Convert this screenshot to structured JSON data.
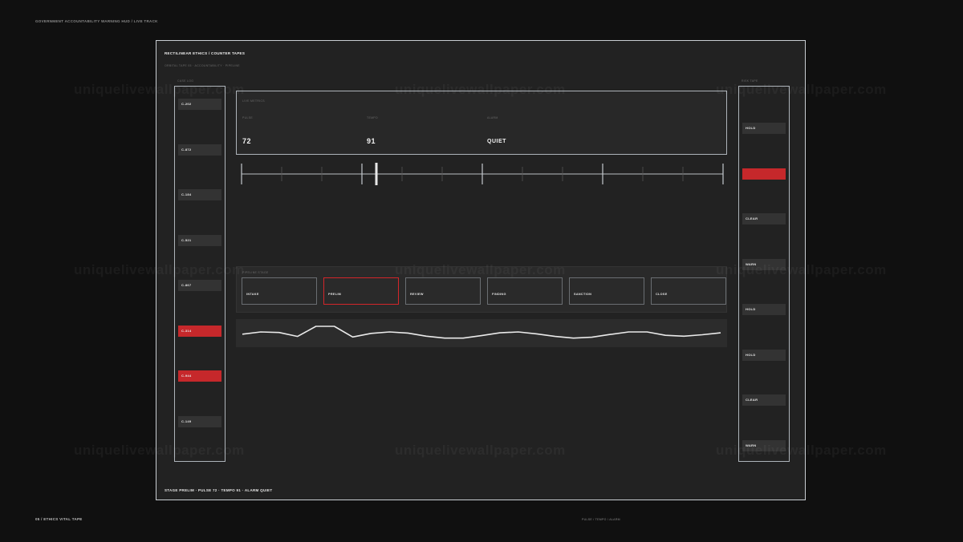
{
  "header": {
    "caption": "GOVERNMENT ACCOUNTABILITY WARNING HUD / LIVE TRACK"
  },
  "footer": {
    "left": "05 / ETHICS VITAL TAPE",
    "middle": "PULSE / TEMPO / ALARM"
  },
  "frame": {
    "title": "RECTILINEAR ETHICS / COUNTER TAPES",
    "subtitle": "ORBITAL TAPE 05 · ACCOUNTABILITY · PIPELINE",
    "status": "STAGE PRELIM · PULSE 72 · TEMPO 91 · ALARM QUIET"
  },
  "left_tape": {
    "label": "CASE LOG",
    "items": [
      {
        "label": "C-202",
        "alert": false
      },
      {
        "label": "C-872",
        "alert": false
      },
      {
        "label": "C-184",
        "alert": false
      },
      {
        "label": "C-521",
        "alert": false
      },
      {
        "label": "C-867",
        "alert": false
      },
      {
        "label": "C-314",
        "alert": true
      },
      {
        "label": "C-944",
        "alert": true
      },
      {
        "label": "C-149",
        "alert": false
      }
    ]
  },
  "right_tape": {
    "label": "RISK TAPE",
    "items": [
      {
        "label": "HOLD",
        "alert": false
      },
      {
        "label": "",
        "alert": true
      },
      {
        "label": "CLEAR",
        "alert": false
      },
      {
        "label": "WARN",
        "alert": false
      },
      {
        "label": "HOLD",
        "alert": false
      },
      {
        "label": "HOLD",
        "alert": false
      },
      {
        "label": "CLEAR",
        "alert": false
      },
      {
        "label": "WARN",
        "alert": false
      }
    ]
  },
  "readout": {
    "caption": "LIVE METRICS",
    "metrics": [
      {
        "label": "PULSE",
        "value": "72"
      },
      {
        "label": "TEMPO",
        "value": "91"
      },
      {
        "label": "ALARM",
        "value": "QUIET"
      }
    ]
  },
  "scale": {
    "min": 0,
    "max": 100,
    "marker": 28
  },
  "stages": {
    "caption": "PIPELINE STAGE",
    "items": [
      "INTAKE",
      "PRELIM",
      "REVIEW",
      "FINDING",
      "SANCTION",
      "CLOSE"
    ],
    "active": 1
  },
  "trace": {
    "values": [
      52,
      60,
      58,
      44,
      80,
      80,
      42,
      55,
      60,
      56,
      45,
      38,
      38,
      47,
      57,
      60,
      53,
      44,
      38,
      41,
      51,
      60,
      60,
      48,
      45,
      50,
      57
    ]
  },
  "watermark": "uniquelivewallpaper.com",
  "colors": {
    "alert": "#c6282b",
    "frame": "#c9ced3",
    "background": "#101010"
  }
}
